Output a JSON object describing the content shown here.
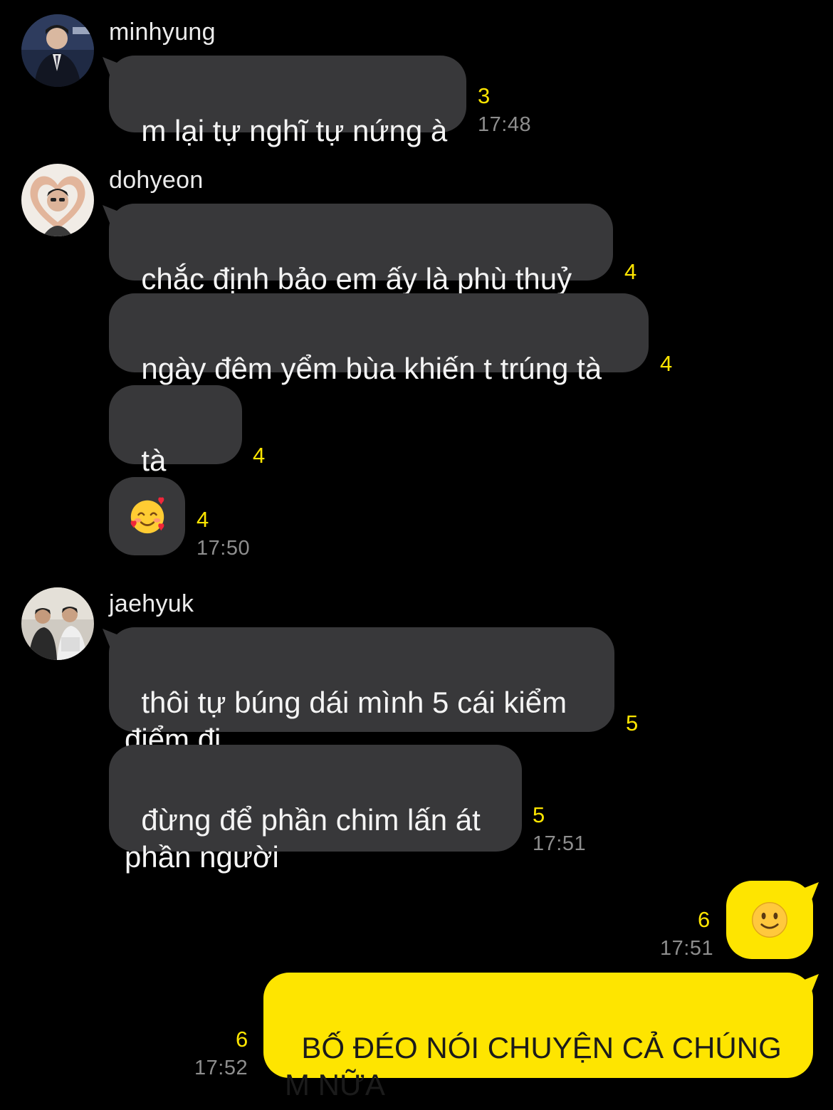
{
  "colors": {
    "background": "#000000",
    "incoming_bubble": "#38383a",
    "outgoing_bubble": "#fee500",
    "unread_count": "#fee500",
    "timestamp": "#8e8e8e"
  },
  "groups": [
    {
      "sender": "minhyung",
      "avatar_icon": "profile-photo-suit-icon",
      "messages": [
        {
          "text": "m lại tự nghĩ tự nứng à",
          "unread": "3",
          "time": "17:48"
        }
      ]
    },
    {
      "sender": "dohyeon",
      "avatar_icon": "profile-photo-heart-hands-icon",
      "messages": [
        {
          "text": "chắc định bảo em ấy là phù thuỷ",
          "unread": "4"
        },
        {
          "text": "ngày đêm yểm bùa khiến t trúng tà",
          "unread": "4"
        },
        {
          "text": "tà dâm",
          "unread": "4"
        },
        {
          "emoji": "smiling-face-with-hearts-emoji",
          "unread": "4",
          "time": "17:50"
        }
      ]
    },
    {
      "sender": "jaehyuk",
      "avatar_icon": "profile-photo-group-icon",
      "messages": [
        {
          "text": "thôi tự búng dái mình 5 cái kiểm\nđiểm đi",
          "unread": "5"
        },
        {
          "text": "đừng để phần chim lấn át\nphần người",
          "unread": "5",
          "time": "17:51"
        }
      ]
    }
  ],
  "my_messages": [
    {
      "emoji": "slightly-smiling-face-emoji",
      "unread": "6",
      "time": "17:51"
    },
    {
      "text": "BỐ ĐÉO NÓI CHUYỆN CẢ CHÚNG\nM NỮA",
      "unread": "6",
      "time": "17:52"
    }
  ]
}
